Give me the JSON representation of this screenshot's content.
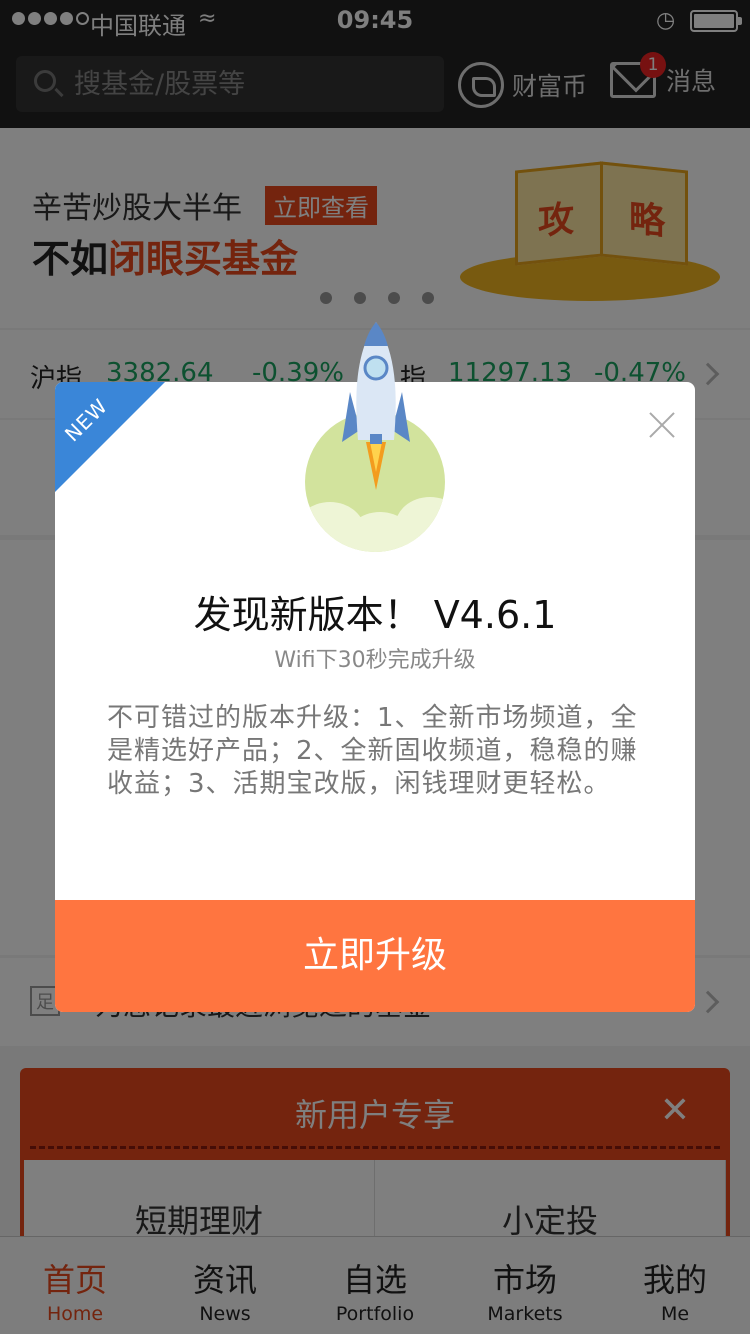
{
  "status_bar": {
    "carrier": "中国联通",
    "time": "09:45",
    "wifi_icon": "wifi-icon",
    "alarm_icon": "alarm-icon"
  },
  "header": {
    "search_placeholder": "搜基金/股票等",
    "coin_label": "财富币",
    "message_label": "消息",
    "message_badge": "1"
  },
  "banner": {
    "line1": "辛苦炒股大半年",
    "tag": "立即查看",
    "line2_prefix": "不如",
    "line2_highlight": "闭眼买基金",
    "book_left": "攻",
    "book_right": "略"
  },
  "ticker": {
    "sh_label": "沪指",
    "sh_value": "3382.64",
    "sh_change": "-0.39%",
    "sz_label": "指",
    "sz_value": "11297.13",
    "sz_change": "-0.47%"
  },
  "notice": {
    "tag": "足",
    "text": "为您记录最近浏览过的基金"
  },
  "promo": {
    "title": "新用户专享",
    "card1": "短期理财",
    "card2": "小定投"
  },
  "tabs": [
    {
      "zh": "首页",
      "en": "Home"
    },
    {
      "zh": "资讯",
      "en": "News"
    },
    {
      "zh": "自选",
      "en": "Portfolio"
    },
    {
      "zh": "市场",
      "en": "Markets"
    },
    {
      "zh": "我的",
      "en": "Me"
    }
  ],
  "modal": {
    "ribbon": "NEW",
    "title": "发现新版本！ V4.6.1",
    "subtitle": "Wifi下30秒完成升级",
    "body": "不可错过的版本升级：1、全新市场频道，全是精选好产品；2、全新固收频道，稳稳的赚收益；3、活期宝改版，闲钱理财更轻松。",
    "button": "立即升级"
  },
  "colors": {
    "accent": "#ff7540",
    "brand": "#e8491d",
    "ribbon": "#3a86d8"
  }
}
